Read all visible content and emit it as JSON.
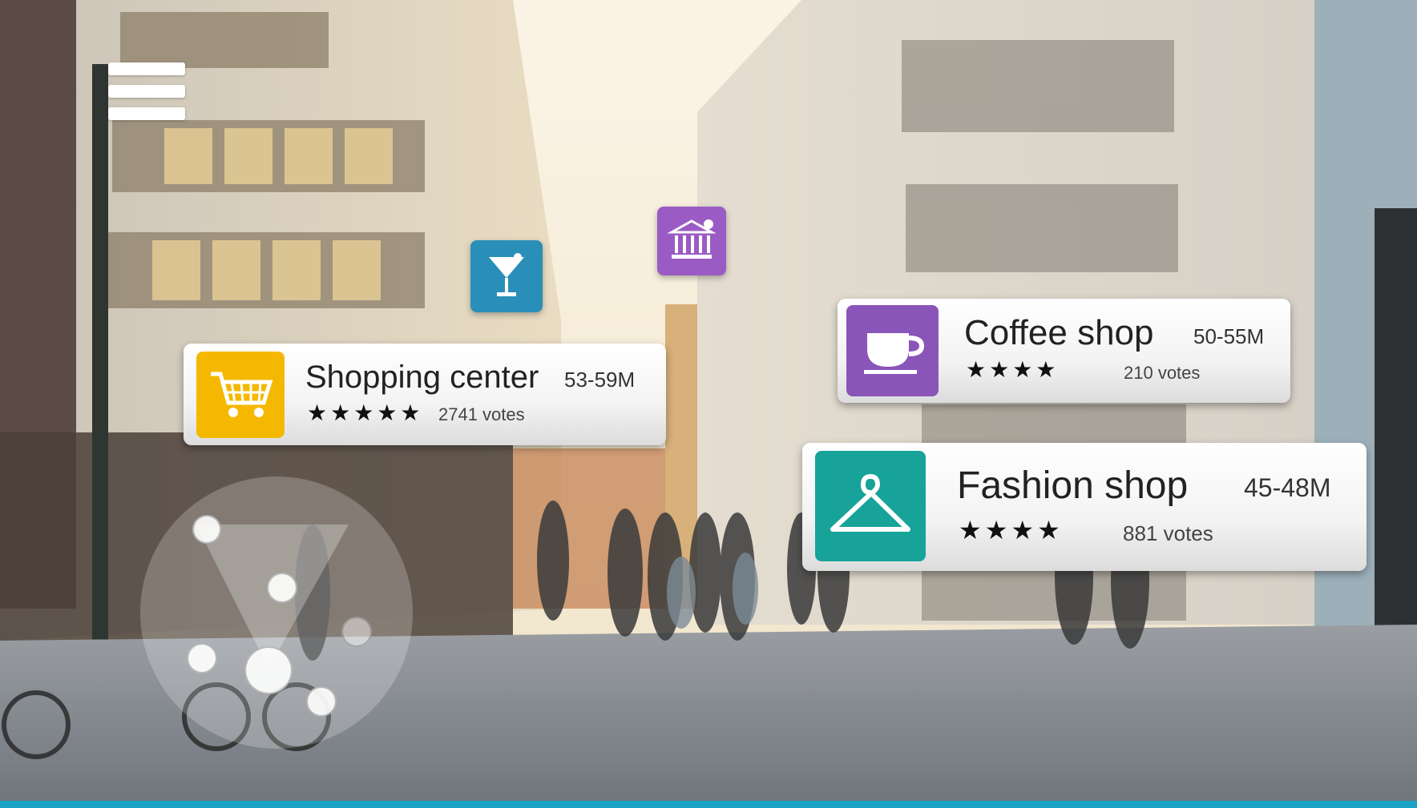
{
  "menu": {
    "icon": "hamburger-menu-icon"
  },
  "poi_markers": [
    {
      "icon": "cocktail-icon",
      "color": "#2a8fb8"
    },
    {
      "icon": "bank-icon",
      "color": "#9a5cc4"
    }
  ],
  "cards": {
    "shopping": {
      "name": "Shopping center",
      "distance": "53-59M",
      "stars": "★★★★★",
      "votes": "2741 votes",
      "icon": "shopping-cart-icon",
      "color": "#f5b800"
    },
    "coffee": {
      "name": "Coffee shop",
      "distance": "50-55M",
      "stars": "★★★★",
      "votes": "210 votes",
      "icon": "coffee-cup-icon",
      "color": "#8a55b8"
    },
    "fashion": {
      "name": "Fashion  shop",
      "distance": "45-48M",
      "stars": "★★★★",
      "votes": "881 votes",
      "icon": "hanger-icon",
      "color": "#17a39a"
    }
  },
  "radar": {
    "icon": "radar-minimap"
  },
  "accent_color": "#1aa3c4"
}
